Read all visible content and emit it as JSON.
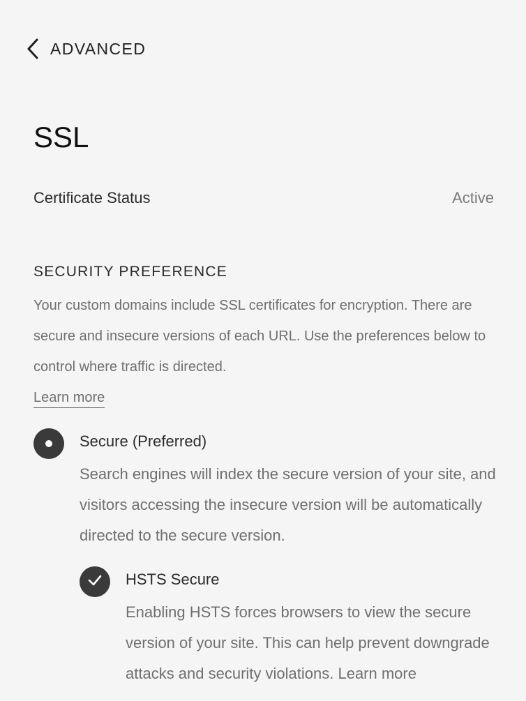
{
  "nav": {
    "back_label": "ADVANCED",
    "back_icon": "chevron-left-icon"
  },
  "page": {
    "title": "SSL"
  },
  "certificate": {
    "label": "Certificate Status",
    "status": "Active"
  },
  "security_preference": {
    "heading": "SECURITY PREFERENCE",
    "description": "Your custom domains include SSL certificates for encryption. There are secure and insecure versions of each URL. Use the preferences below to control where traffic is directed.",
    "learn_more_label": "Learn more",
    "options": [
      {
        "title": "Secure (Preferred)",
        "description": "Search engines will index the secure version of your site, and visitors accessing the insecure version will be automatically directed to the secure version.",
        "selected": true
      }
    ],
    "hsts": {
      "title": "HSTS Secure",
      "description": "Enabling HSTS forces browsers to view the secure version of your site. This can help prevent downgrade attacks and security violations. Learn more",
      "checked": true
    }
  },
  "colors": {
    "background": "#f5f5f5",
    "control_fill": "#3a3a3a",
    "muted_text": "#6f6f6f"
  }
}
